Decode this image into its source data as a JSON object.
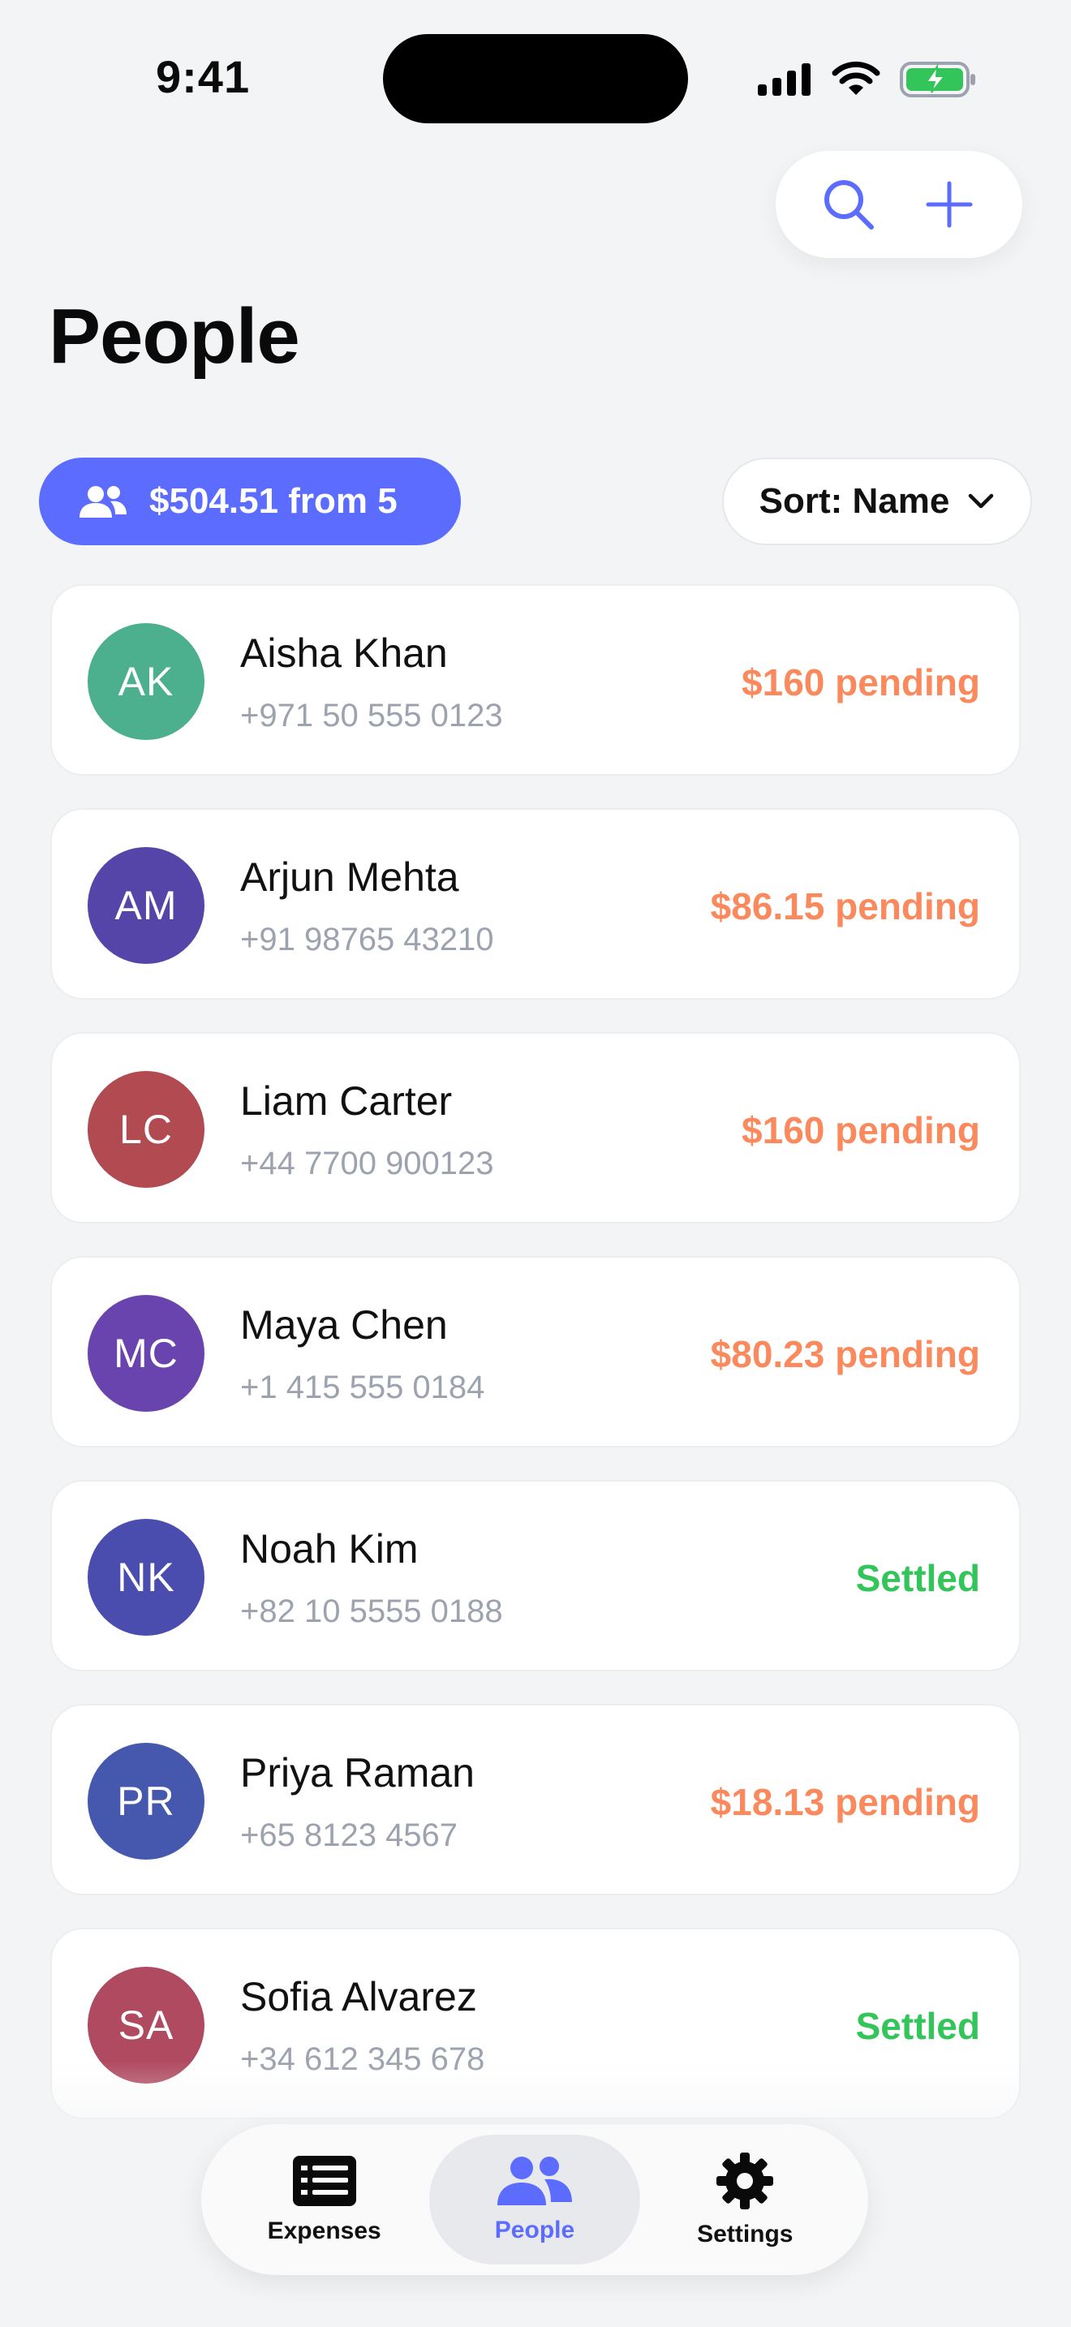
{
  "status_bar": {
    "time": "9:41"
  },
  "header": {
    "title": "People",
    "search_icon": "search-icon",
    "add_icon": "plus-icon"
  },
  "summary": {
    "label": "$504.51 from 5",
    "icon": "people-icon"
  },
  "sort": {
    "label": "Sort: Name",
    "icon": "chevron-down-icon"
  },
  "people": [
    {
      "initials": "AK",
      "name": "Aisha Khan",
      "phone": "+971 50 555 0123",
      "status": "$160 pending",
      "state": "pending",
      "color": "#4CAF8E"
    },
    {
      "initials": "AM",
      "name": "Arjun Mehta",
      "phone": "+91 98765 43210",
      "status": "$86.15 pending",
      "state": "pending",
      "color": "#5645A8"
    },
    {
      "initials": "LC",
      "name": "Liam Carter",
      "phone": "+44 7700 900123",
      "status": "$160 pending",
      "state": "pending",
      "color": "#B24A52"
    },
    {
      "initials": "MC",
      "name": "Maya Chen",
      "phone": "+1 415 555 0184",
      "status": "$80.23 pending",
      "state": "pending",
      "color": "#6A44AE"
    },
    {
      "initials": "NK",
      "name": "Noah Kim",
      "phone": "+82 10 5555 0188",
      "status": "Settled",
      "state": "settled",
      "color": "#4A4DAE"
    },
    {
      "initials": "PR",
      "name": "Priya Raman",
      "phone": "+65 8123 4567",
      "status": "$18.13 pending",
      "state": "pending",
      "color": "#4658AE"
    },
    {
      "initials": "SA",
      "name": "Sofia Alvarez",
      "phone": "+34 612 345 678",
      "status": "Settled",
      "state": "settled",
      "color": "#B04A60"
    }
  ],
  "tabs": [
    {
      "label": "Expenses",
      "icon": "list-icon",
      "active": false
    },
    {
      "label": "People",
      "icon": "people-icon",
      "active": true
    },
    {
      "label": "Settings",
      "icon": "gear-icon",
      "active": false
    }
  ],
  "colors": {
    "accent": "#5B6CFF",
    "pending": "#FA8A5E",
    "settled": "#34C55A",
    "background": "#F3F4F6"
  }
}
